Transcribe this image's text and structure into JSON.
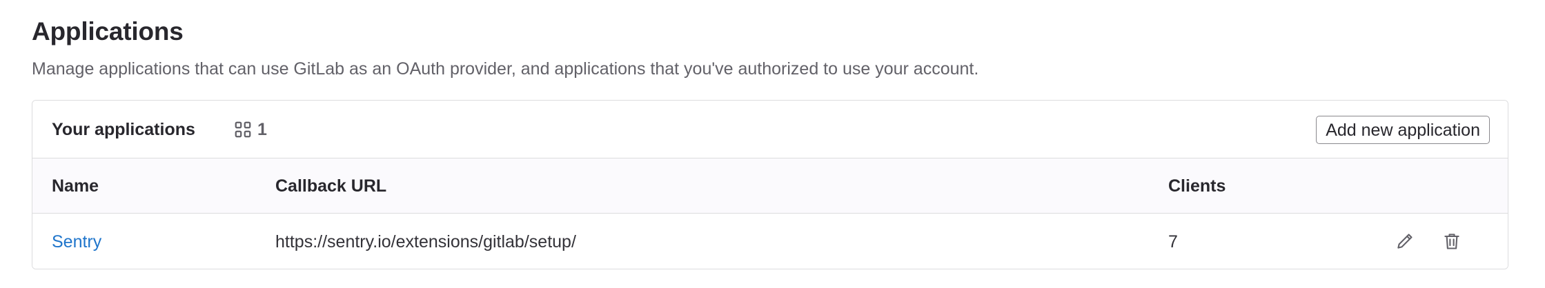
{
  "page": {
    "title": "Applications",
    "description": "Manage applications that can use GitLab as an OAuth provider, and applications that you've authorized to use your account."
  },
  "your_applications": {
    "title": "Your applications",
    "count_icon": "applications-grid-icon",
    "count": "1",
    "add_button_label": "Add new application",
    "columns": [
      "Name",
      "Callback URL",
      "Clients"
    ],
    "rows": [
      {
        "name": "Sentry",
        "callback_url": "https://sentry.io/extensions/gitlab/setup/",
        "clients": "7",
        "actions": [
          "pencil-icon",
          "trash-icon"
        ]
      }
    ]
  },
  "colors": {
    "link": "#1f75cb",
    "text": "#28272d",
    "muted": "#626168",
    "border": "#dcdcde",
    "header_bg": "#fbfafd"
  }
}
